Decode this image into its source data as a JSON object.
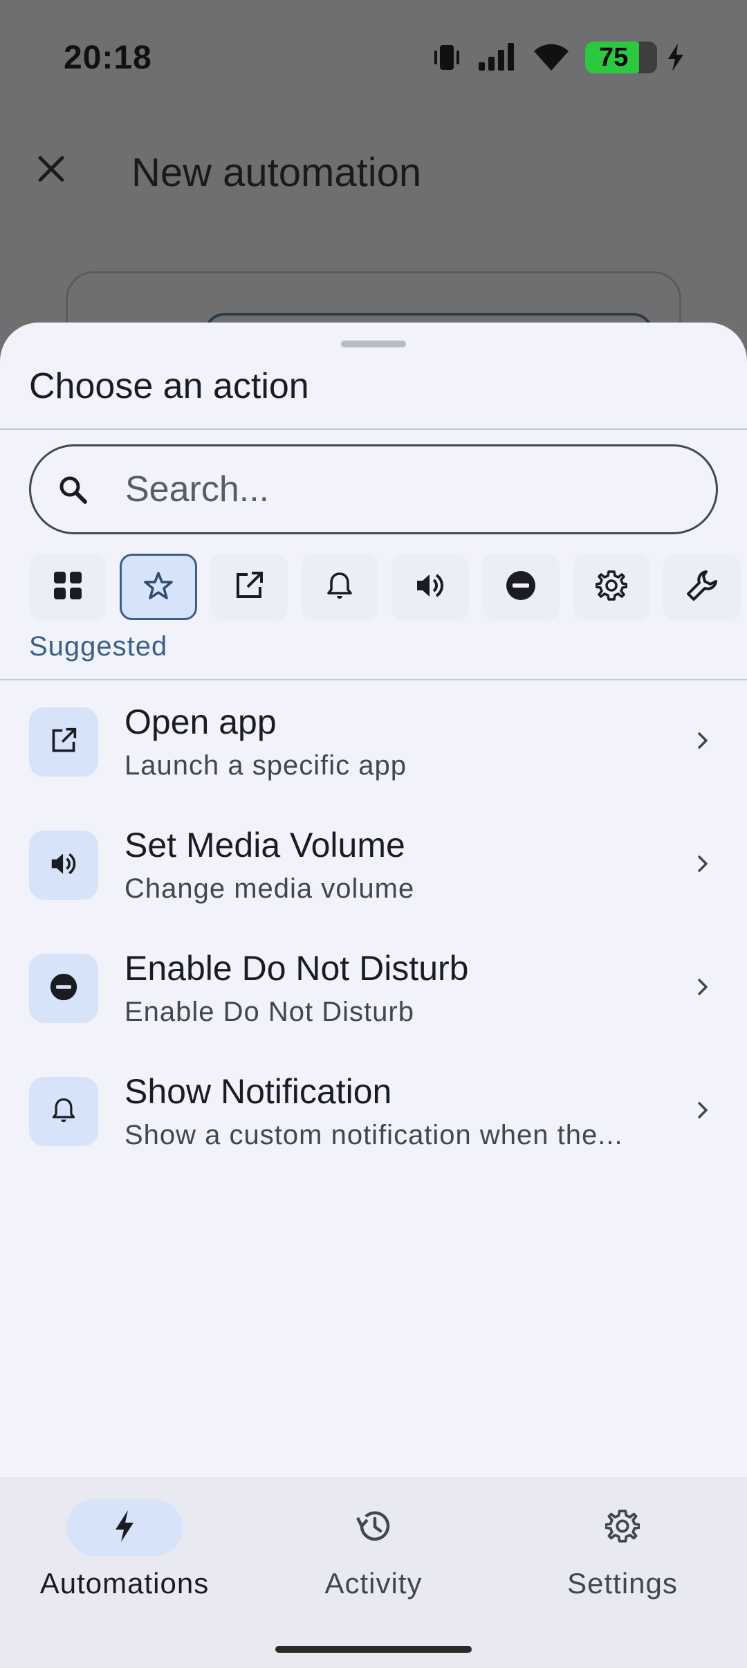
{
  "status_bar": {
    "time": "20:18",
    "battery_level": "75",
    "icons": [
      "vibrate-icon",
      "signal-icon",
      "wifi-icon",
      "battery-icon",
      "charging-icon"
    ]
  },
  "app_bar": {
    "title": "New automation",
    "close_icon": "close-icon"
  },
  "sheet": {
    "title": "Choose an action",
    "search": {
      "placeholder": "Search...",
      "value": ""
    },
    "categories": [
      {
        "icon": "grid-icon",
        "selected": false
      },
      {
        "icon": "star-icon",
        "selected": true
      },
      {
        "icon": "open-external-icon",
        "selected": false
      },
      {
        "icon": "bell-icon",
        "selected": false
      },
      {
        "icon": "volume-icon",
        "selected": false
      },
      {
        "icon": "do-not-disturb-icon",
        "selected": false
      },
      {
        "icon": "gear-icon",
        "selected": false
      },
      {
        "icon": "wrench-icon",
        "selected": false
      }
    ],
    "selected_category_label": "Suggested",
    "actions": [
      {
        "title": "Open app",
        "subtitle": "Launch a specific app",
        "icon": "open-external-icon"
      },
      {
        "title": "Set Media Volume",
        "subtitle": "Change media volume",
        "icon": "volume-icon"
      },
      {
        "title": "Enable Do Not Disturb",
        "subtitle": "Enable Do Not Disturb",
        "icon": "do-not-disturb-icon"
      },
      {
        "title": "Show Notification",
        "subtitle": "Show a custom notification when the...",
        "icon": "bell-icon"
      }
    ]
  },
  "bottom_nav": {
    "items": [
      {
        "label": "Automations",
        "icon": "bolt-icon",
        "active": true
      },
      {
        "label": "Activity",
        "icon": "history-icon",
        "active": false
      },
      {
        "label": "Settings",
        "icon": "gear-icon",
        "active": false
      }
    ]
  },
  "colors": {
    "accent": "#3a5f8a",
    "accent_container": "#d6e3f8",
    "sheet_background": "#f1f2fa",
    "scrim": "#6f6f71",
    "battery_green": "#2bc840"
  }
}
